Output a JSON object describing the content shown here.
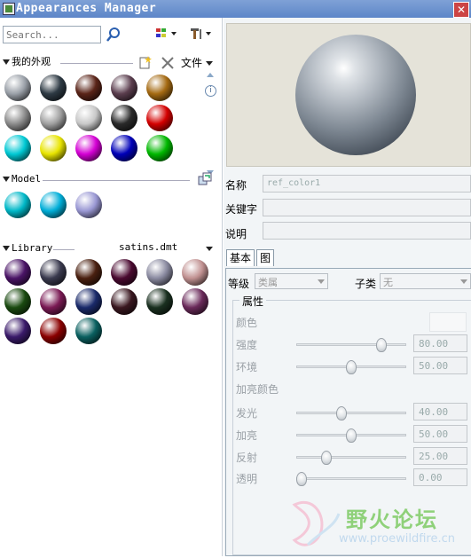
{
  "window": {
    "title": "Appearances Manager",
    "close_glyph": "✕"
  },
  "toolbar": {
    "search_placeholder": "Search...",
    "icons": [
      "search-icon",
      "view-mode-icon",
      "tools-icon"
    ]
  },
  "my_appearances": {
    "title": "我的外观",
    "file_menu": "文件"
  },
  "model": {
    "title": "Model"
  },
  "library": {
    "title": "Library",
    "file": "satins.dmt"
  },
  "swatch_colors": {
    "my": [
      [
        "#9aa0a8",
        "#2e3a44",
        "#5a2418",
        "#5b3e4e",
        "#a56a12"
      ],
      [
        "#8c8c8c",
        "#a0a0a0",
        "#c8c8c8",
        "#2a2a2a",
        "#d40000"
      ],
      [
        "#00c9d4",
        "#e8e400",
        "#d400d4",
        "#0000b8",
        "#00b800"
      ]
    ],
    "model": [
      "#00b8c8",
      "#00aed8",
      "#9a98d4"
    ],
    "library": [
      [
        "#4a1466",
        "#3a3a4e",
        "#4a2010",
        "#4a0a30",
        "#8a8aa0",
        "#c09090"
      ],
      [
        "#1a4a10",
        "#7a1a54",
        "#1a2a6a",
        "#3a1820",
        "#1a3020",
        "#6a2a5a"
      ],
      [
        "#3a1a6a",
        "#8a0000",
        "#0a6060"
      ]
    ]
  },
  "properties": {
    "name_label": "名称",
    "name_value": "ref_color1",
    "keyword_label": "关键字",
    "keyword_value": "",
    "desc_label": "说明",
    "desc_value": ""
  },
  "tabs": [
    "基本",
    "图"
  ],
  "basic": {
    "class_label": "等级",
    "class_value": "类属",
    "subclass_label": "子类",
    "subclass_value": "无",
    "group_title": "属性",
    "color_label": "颜色",
    "highlight_label": "加亮颜色",
    "sliders": [
      {
        "label": "强度",
        "value": "80.00",
        "pct": 0.8
      },
      {
        "label": "环境",
        "value": "50.00",
        "pct": 0.5
      },
      {
        "label": "发光",
        "value": "40.00",
        "pct": 0.4
      },
      {
        "label": "加亮",
        "value": "50.00",
        "pct": 0.5
      },
      {
        "label": "反射",
        "value": "25.00",
        "pct": 0.25
      },
      {
        "label": "透明",
        "value": "0.00",
        "pct": 0.0
      }
    ]
  },
  "watermark": {
    "text": "野火论坛",
    "url": "www.proewildfire.cn"
  }
}
